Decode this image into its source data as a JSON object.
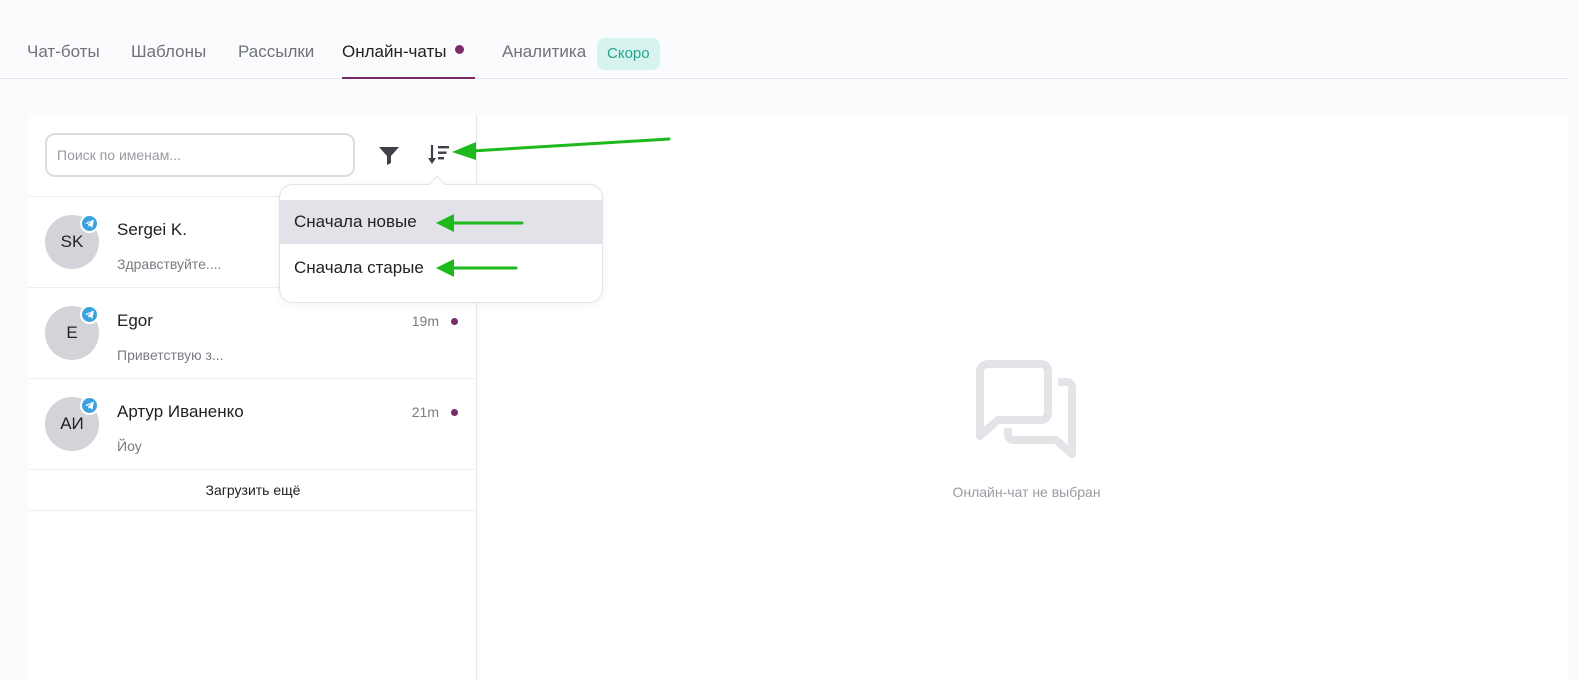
{
  "tabs": [
    {
      "label": "Чат-боты"
    },
    {
      "label": "Шаблоны"
    },
    {
      "label": "Рассылки"
    },
    {
      "label": "Онлайн-чаты"
    },
    {
      "label": "Аналитика",
      "badge": "Скоро"
    }
  ],
  "active_tab": "Онлайн-чаты",
  "search": {
    "placeholder": "Поиск по именам..."
  },
  "toolbar": {
    "filter_icon": "filter-icon",
    "sort_icon": "sort-icon"
  },
  "sort_menu": {
    "options": [
      {
        "label": "Сначала новые",
        "selected": true
      },
      {
        "label": "Сначала старые",
        "selected": false
      }
    ]
  },
  "chats": [
    {
      "initials": "SK",
      "name": "Sergei K.",
      "preview": "Здравствуйте....",
      "time": "",
      "unread": false,
      "channel": "telegram-icon"
    },
    {
      "initials": "E",
      "name": "Egor",
      "preview": "Приветствую з...",
      "time": "19m",
      "unread": true,
      "channel": "telegram-icon"
    },
    {
      "initials": "АИ",
      "name": "Артур Иваненко",
      "preview": "Йоу",
      "time": "21m",
      "unread": true,
      "channel": "telegram-icon"
    }
  ],
  "load_more": "Загрузить ещё",
  "empty_state": {
    "text": "Онлайн-чат не выбран",
    "icon": "chat-bubbles-icon"
  },
  "colors": {
    "accent": "#7a2b6c",
    "badge_bg": "#d6f3ee",
    "badge_text": "#23a58e",
    "telegram": "#3ba2e0",
    "annotation_arrow": "#1db91d"
  }
}
